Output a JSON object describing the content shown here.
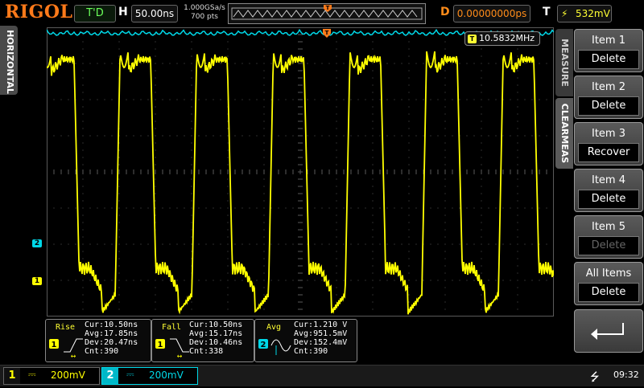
{
  "topbar": {
    "logo": "RIGOL",
    "run_status": "T'D",
    "h_label": "H",
    "timebase": "50.00ns",
    "sample_rate": "1.000GSa/s",
    "memory_depth": "700 pts",
    "d_label": "D",
    "delay": "0.00000000ps",
    "t_label": "T",
    "trigger_level": "532mV"
  },
  "left_tab": {
    "label": "HORIZONTAL"
  },
  "screen": {
    "frequency_readout": "10.5832MHz",
    "frequency_badge": "T",
    "ch2_marker": "2",
    "ch1_marker": "1"
  },
  "measurements": [
    {
      "title": "Rise",
      "channel": "1",
      "cur": "Cur:10.50ns",
      "avg": "Avg:17.85ns",
      "dev": "Dev:20.47ns",
      "cnt": "Cnt:390"
    },
    {
      "title": "Fall",
      "channel": "1",
      "cur": "Cur:10.50ns",
      "avg": "Avg:15.17ns",
      "dev": "Dev:10.46ns",
      "cnt": "Cnt:338"
    },
    {
      "title": "Avg",
      "channel": "2",
      "cur": "Cur:1.210 V",
      "avg": "Avg:951.5mV",
      "dev": "Dev:152.4mV",
      "cnt": "Cnt:390"
    }
  ],
  "side_tabs": {
    "measure": "MEASURE",
    "clear_meas": "CLEARMEAS"
  },
  "menu": [
    {
      "label": "Item 1",
      "action": "Delete",
      "enabled": true
    },
    {
      "label": "Item 2",
      "action": "Delete",
      "enabled": true
    },
    {
      "label": "Item 3",
      "action": "Recover",
      "enabled": true
    },
    {
      "label": "Item 4",
      "action": "Delete",
      "enabled": true
    },
    {
      "label": "Item 5",
      "action": "Delete",
      "enabled": false
    },
    {
      "label": "All Items",
      "action": "Delete",
      "enabled": true
    }
  ],
  "bottombar": {
    "ch1": {
      "number": "1",
      "coupling": "⎓",
      "scale": "200mV"
    },
    "ch2": {
      "number": "2",
      "coupling": "⎓",
      "scale": "200mV"
    },
    "time": "09:32"
  },
  "colors": {
    "ch1": "#ffff00",
    "ch2": "#00d8e8",
    "accent": "#ff7a1a",
    "grid": "#5a5a5a"
  }
}
